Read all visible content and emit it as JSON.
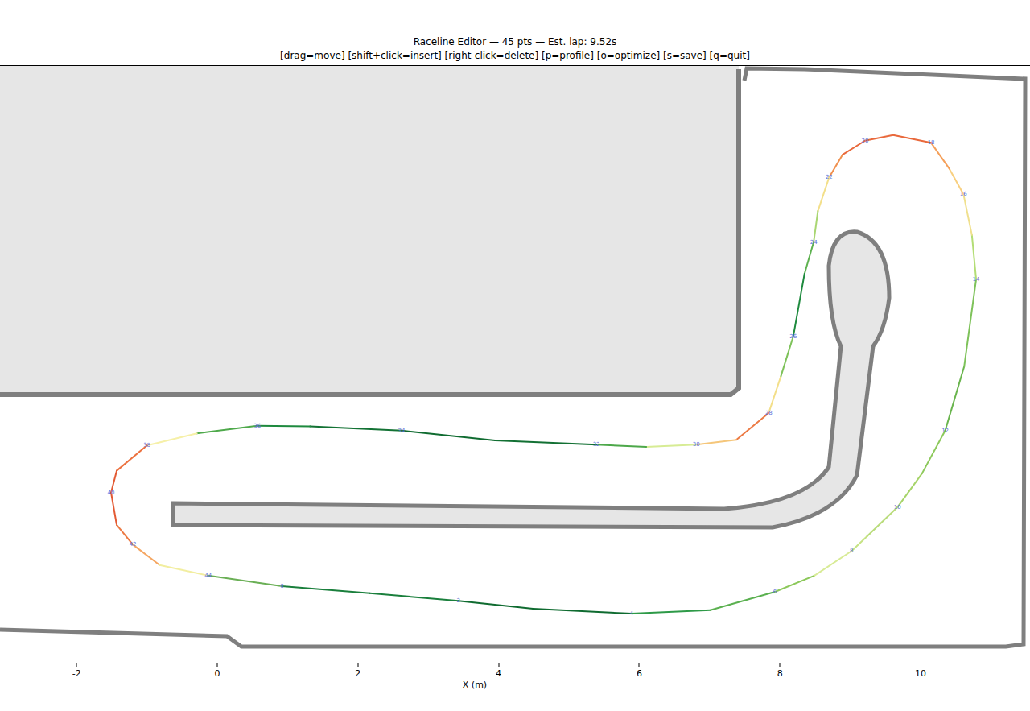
{
  "window": {
    "title": "Raceline Editor — 45 pts — Est. lap: 9.52s",
    "subtitle": "[drag=move] [shift+click=insert] [right-click=delete] [p=profile] [o=optimize] [s=save] [q=quit]"
  },
  "x_axis": {
    "label": "X (m)",
    "ticks": [
      {
        "label": "-2",
        "value": -2
      },
      {
        "label": "0",
        "value": 0
      },
      {
        "label": "2",
        "value": 2
      },
      {
        "label": "4",
        "value": 4
      },
      {
        "label": "6",
        "value": 6
      },
      {
        "label": "8",
        "value": 8
      },
      {
        "label": "10",
        "value": 10
      }
    ]
  },
  "raceline": [
    {
      "label": "0",
      "x": 0.92,
      "y": -0.32,
      "color": "#1a7f3c"
    },
    {
      "label": "",
      "x": 2.17,
      "y": -0.42,
      "color": "#1a7f3c"
    },
    {
      "label": "2",
      "x": 3.43,
      "y": -0.53,
      "color": "#0f6b30"
    },
    {
      "label": "",
      "x": 4.49,
      "y": -0.64,
      "color": "#0f6b30"
    },
    {
      "label": "4",
      "x": 5.89,
      "y": -0.71,
      "color": "#2e9a48"
    },
    {
      "label": "",
      "x": 7.01,
      "y": -0.66,
      "color": "#5ab04f"
    },
    {
      "label": "6",
      "x": 7.93,
      "y": -0.4,
      "color": "#8cc85a"
    },
    {
      "label": "",
      "x": 8.49,
      "y": -0.17,
      "color": "#d8eb96"
    },
    {
      "label": "8",
      "x": 9.02,
      "y": 0.18,
      "color": "#c6e384"
    },
    {
      "label": "",
      "x": 9.24,
      "y": 0.39,
      "color": "#b9dc7a"
    },
    {
      "label": "10",
      "x": 9.67,
      "y": 0.8,
      "color": "#a6d469"
    },
    {
      "label": "",
      "x": 10.02,
      "y": 1.28,
      "color": "#8dc95c"
    },
    {
      "label": "12",
      "x": 10.35,
      "y": 1.89,
      "color": "#6ab54e"
    },
    {
      "label": "",
      "x": 10.62,
      "y": 2.8,
      "color": "#7ec25a"
    },
    {
      "label": "14",
      "x": 10.79,
      "y": 4.04,
      "color": "#b3dd75"
    },
    {
      "label": "",
      "x": 10.73,
      "y": 4.67,
      "color": "#f0e08e"
    },
    {
      "label": "16",
      "x": 10.61,
      "y": 5.25,
      "color": "#f8d080"
    },
    {
      "label": "",
      "x": 10.41,
      "y": 5.61,
      "color": "#f5a05a"
    },
    {
      "label": "18",
      "x": 10.15,
      "y": 5.98,
      "color": "#e9693c"
    },
    {
      "label": "",
      "x": 9.61,
      "y": 6.09,
      "color": "#e9693c"
    },
    {
      "label": "20",
      "x": 9.21,
      "y": 6.01,
      "color": "#e9693c"
    },
    {
      "label": "",
      "x": 8.89,
      "y": 5.81,
      "color": "#f0904e"
    },
    {
      "label": "22",
      "x": 8.7,
      "y": 5.49,
      "color": "#f3df8a"
    },
    {
      "label": "",
      "x": 8.54,
      "y": 5.01,
      "color": "#a9d672"
    },
    {
      "label": "24",
      "x": 8.48,
      "y": 4.57,
      "color": "#5fb251"
    },
    {
      "label": "",
      "x": 8.35,
      "y": 4.12,
      "color": "#1e8a3e"
    },
    {
      "label": "26",
      "x": 8.19,
      "y": 3.23,
      "color": "#7ec25a"
    },
    {
      "label": "",
      "x": 8.01,
      "y": 2.65,
      "color": "#f3df8a"
    },
    {
      "label": "28",
      "x": 7.84,
      "y": 2.14,
      "color": "#ec7a44"
    },
    {
      "label": "",
      "x": 7.38,
      "y": 1.76,
      "color": "#f5c67a"
    },
    {
      "label": "30",
      "x": 6.81,
      "y": 1.69,
      "color": "#d7ec94"
    },
    {
      "label": "",
      "x": 6.1,
      "y": 1.66,
      "color": "#4da84a"
    },
    {
      "label": "32",
      "x": 5.39,
      "y": 1.69,
      "color": "#127033"
    },
    {
      "label": "",
      "x": 3.95,
      "y": 1.75,
      "color": "#0f6b30"
    },
    {
      "label": "34",
      "x": 2.62,
      "y": 1.89,
      "color": "#137234"
    },
    {
      "label": "",
      "x": 1.32,
      "y": 1.95,
      "color": "#1e8a3e"
    },
    {
      "label": "36",
      "x": 0.57,
      "y": 1.96,
      "color": "#4ea94b"
    },
    {
      "label": "",
      "x": -0.29,
      "y": 1.85,
      "color": "#f6f0a8"
    },
    {
      "label": "38",
      "x": -1.0,
      "y": 1.68,
      "color": "#ec7240"
    },
    {
      "label": "",
      "x": -1.43,
      "y": 1.32,
      "color": "#e35a34"
    },
    {
      "label": "40",
      "x": -1.51,
      "y": 1.01,
      "color": "#e35a34"
    },
    {
      "label": "",
      "x": -1.43,
      "y": 0.55,
      "color": "#ec7a44"
    },
    {
      "label": "42",
      "x": -1.2,
      "y": 0.27,
      "color": "#f5a662"
    },
    {
      "label": "",
      "x": -0.82,
      "y": -0.02,
      "color": "#f2eea0"
    },
    {
      "label": "44",
      "x": -0.13,
      "y": -0.17,
      "color": "#6aaf55"
    }
  ]
}
